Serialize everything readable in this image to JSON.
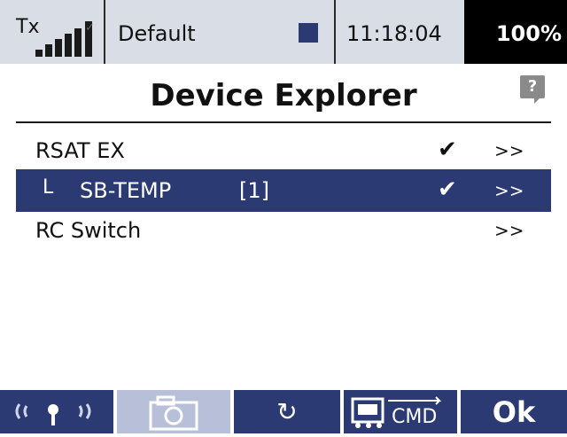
{
  "status_bar": {
    "tx_label": "Tx",
    "model_name": "Default",
    "model_color": "#2b3a73",
    "time": "11:18:04",
    "battery": "100%"
  },
  "header": {
    "title": "Device Explorer",
    "help_label": "?"
  },
  "devices": [
    {
      "name": "RSAT EX",
      "checked": true,
      "check_mark": "✔",
      "arrow": ">>"
    },
    {
      "branch": "L",
      "name": "SB-TEMP",
      "index": "[1]",
      "checked": true,
      "check_mark": "✔",
      "arrow": ">>",
      "selected": true
    },
    {
      "name": "RC Switch",
      "checked": false,
      "arrow": ">>"
    }
  ],
  "toolbar": {
    "refresh_glyph": "↻",
    "ok_label": "Ok",
    "cmd_label": "CMD",
    "icons": [
      "transmitter-signal-icon",
      "camera-icon",
      "refresh-icon",
      "device-cmd-icon"
    ]
  },
  "colors": {
    "accent": "#2b3a73",
    "status_bg": "#d9dde6",
    "toolbar_light": "#b7c0d8"
  }
}
